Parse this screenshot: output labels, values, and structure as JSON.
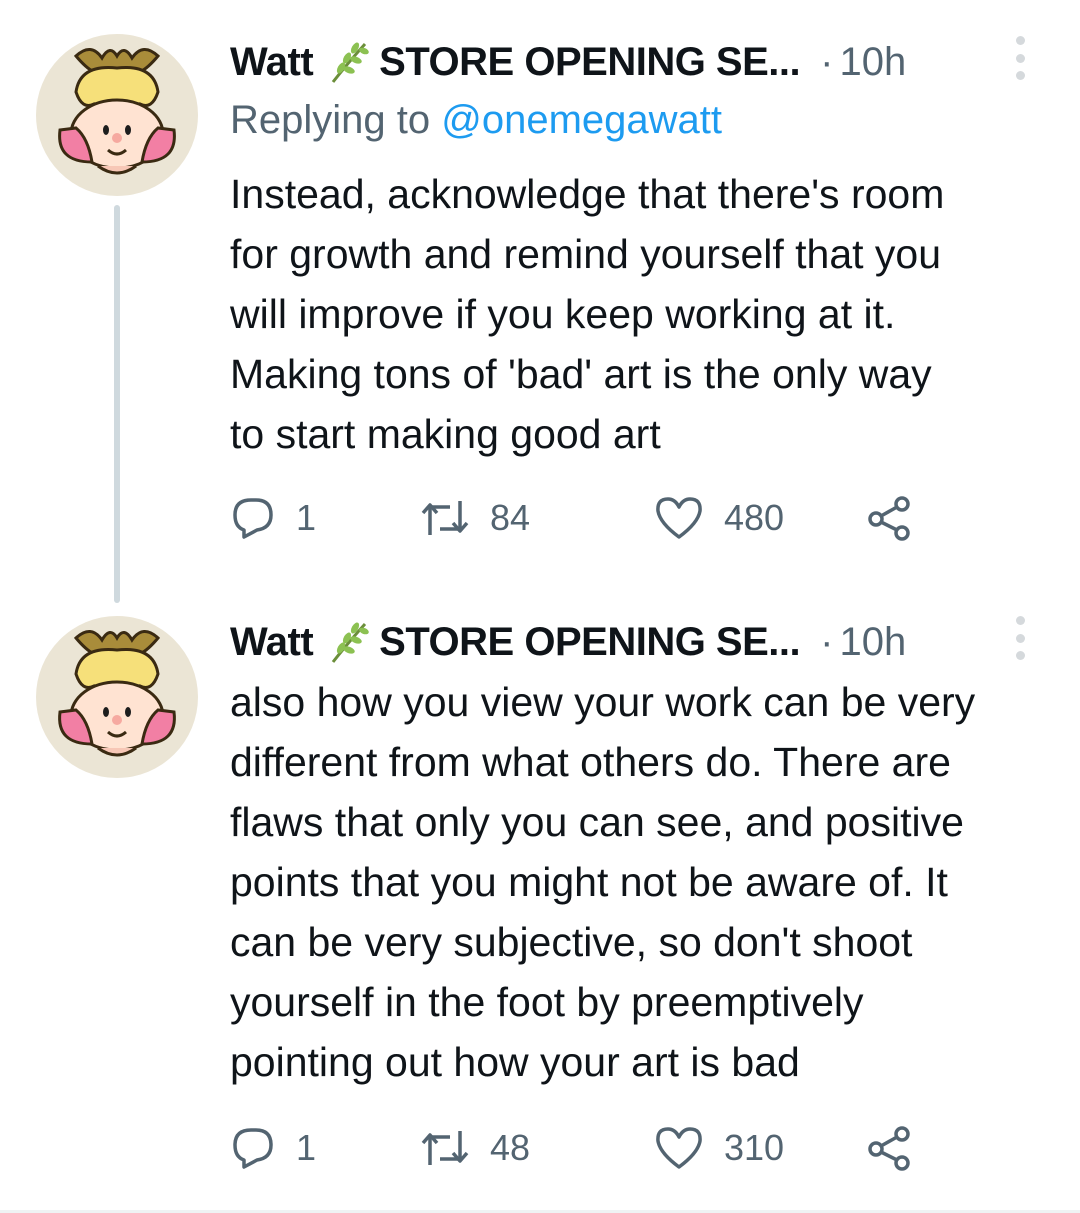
{
  "tweets": [
    {
      "author": "Watt",
      "display_suffix": "STORE OPENING SE...",
      "separator": "·",
      "time": "10h",
      "replying_prefix": "Replying to",
      "replying_handle": "@onemegawatt",
      "text": "Instead, acknowledge that there's room\nfor growth and remind yourself that you\nwill improve if you keep working at it.\nMaking tons of 'bad' art is the only way\nto start making good art",
      "replies": "1",
      "retweets": "84",
      "likes": "480"
    },
    {
      "author": "Watt",
      "display_suffix": "STORE OPENING SE...",
      "separator": "·",
      "time": "10h",
      "text": "also how you view your work can be very\ndifferent from what others do. There are\nflaws that only you can see, and positive\npoints that you might not be aware of. It\ncan be very subjective, so don't shoot\nyourself in the foot by preemptively\npointing out how your art is bad",
      "replies": "1",
      "retweets": "48",
      "likes": "310"
    }
  ],
  "icons": {
    "name_emoji": "herb-icon",
    "reply": "reply-icon",
    "retweet": "retweet-icon",
    "like": "heart-icon",
    "share": "share-icon",
    "more": "more-icon"
  },
  "colors": {
    "text": "#0f1419",
    "secondary": "#536471",
    "mention": "#1d9bf0",
    "thread_line": "#cfd9de",
    "avatar_bg": "#ebe5d5"
  }
}
